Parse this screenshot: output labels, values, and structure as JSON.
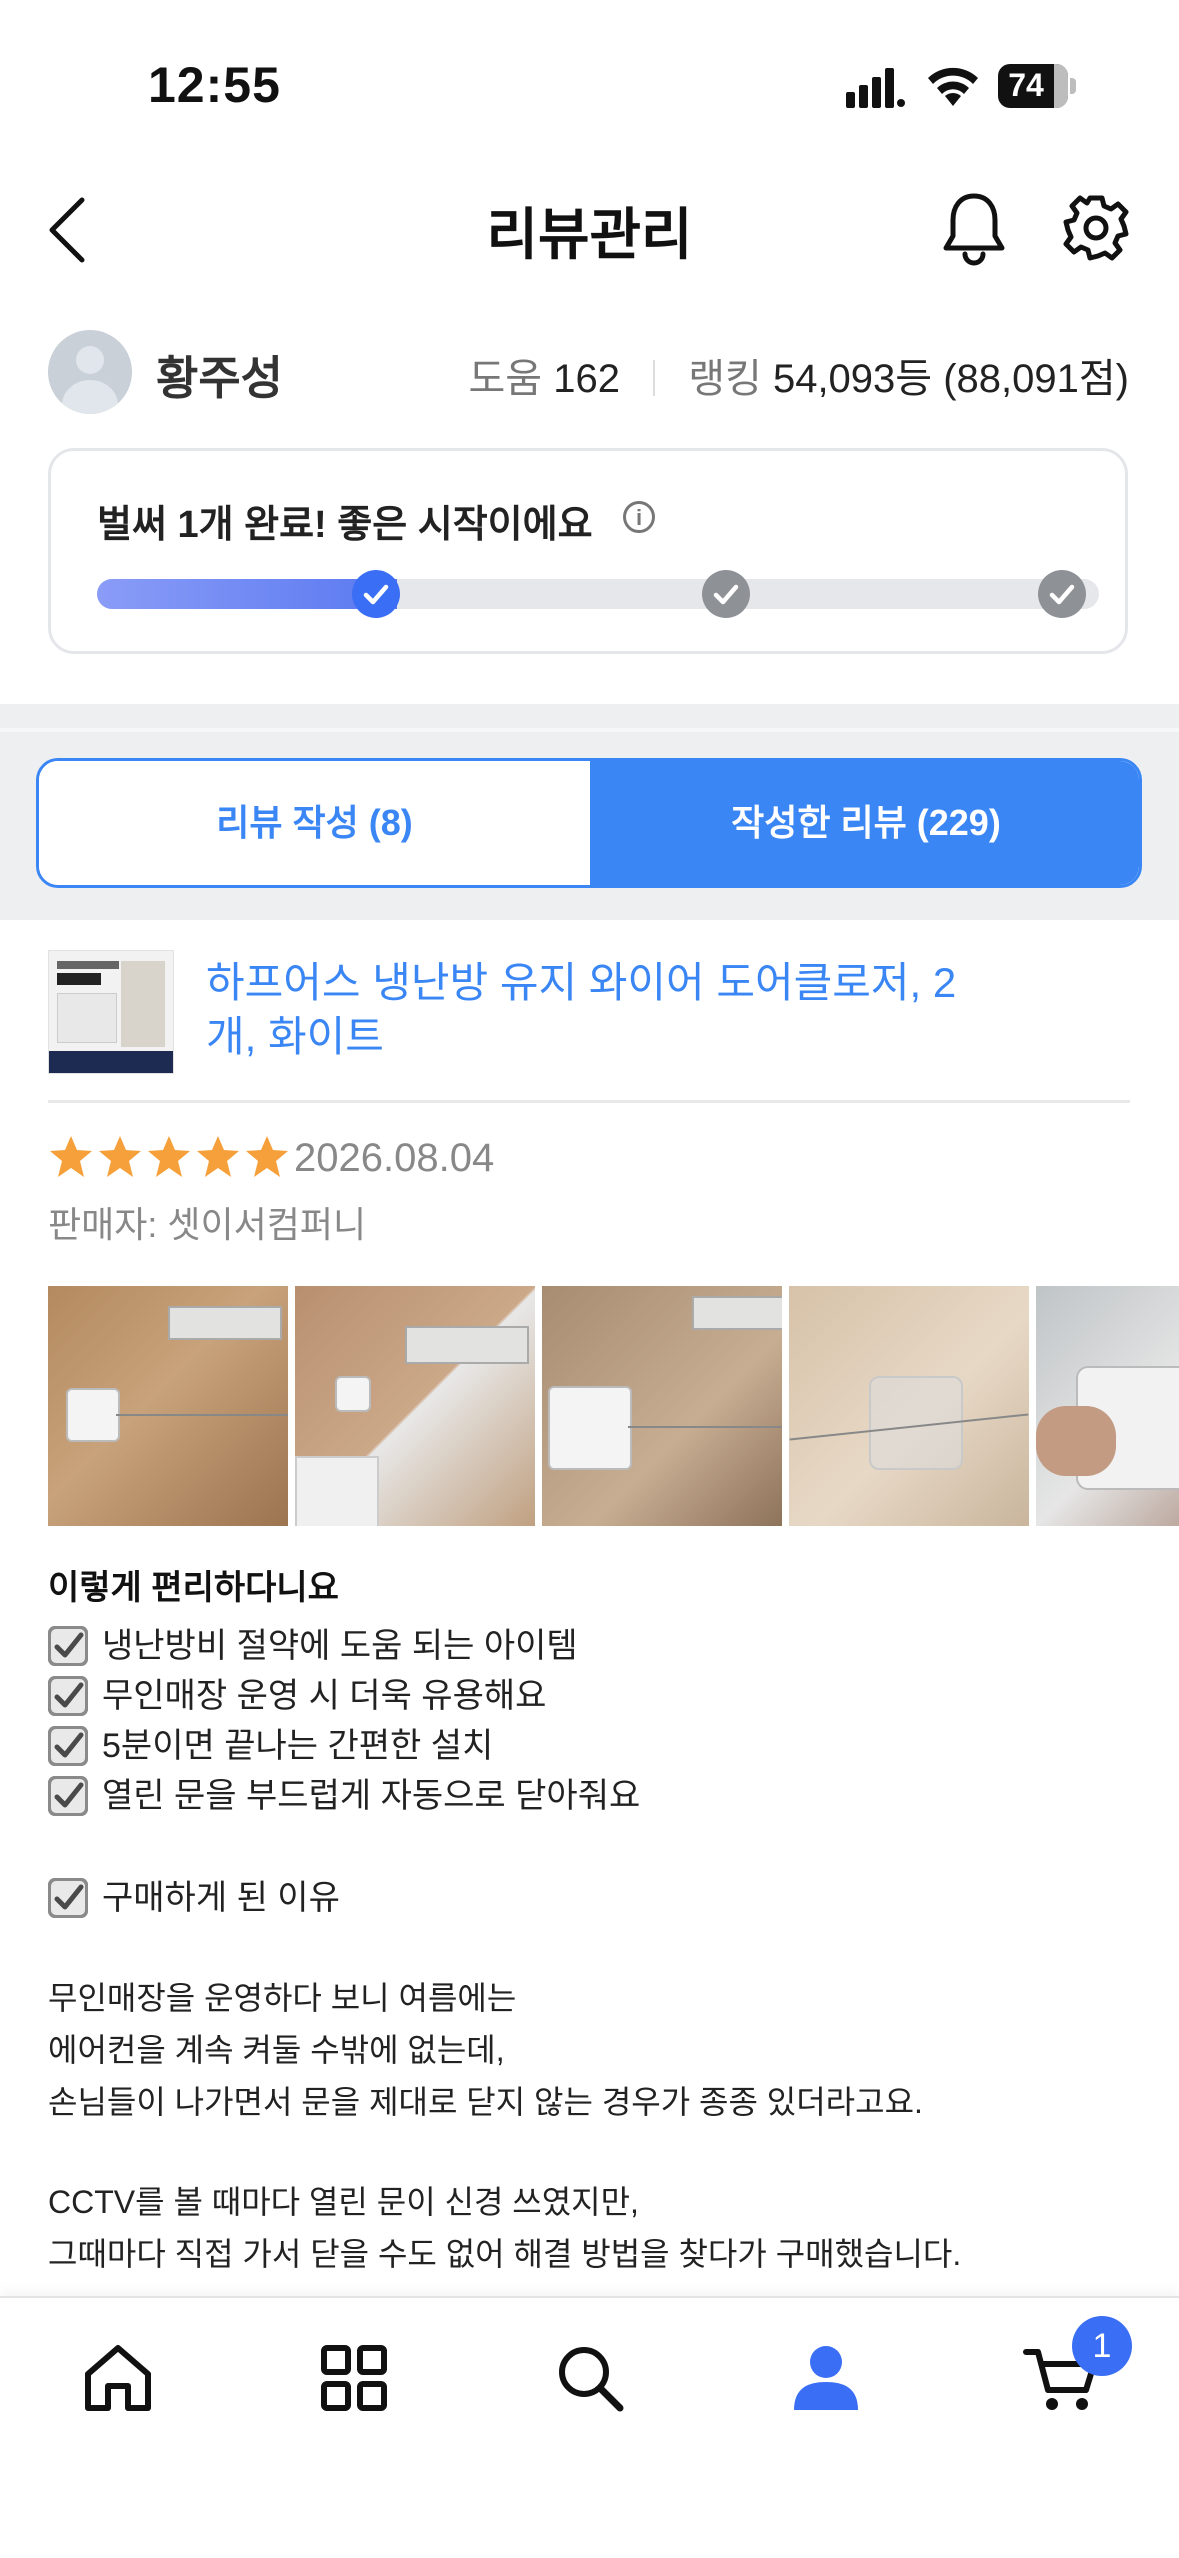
{
  "status_bar": {
    "time": "12:55",
    "battery": "74"
  },
  "header": {
    "title": "리뷰관리"
  },
  "profile": {
    "name": "황주성",
    "help_label": "도움",
    "help_value": "162",
    "ranking_label": "랭킹",
    "ranking_value": "54,093등 (88,091점)"
  },
  "progress": {
    "title": "벌써 1개 완료! 좋은 시작이에요",
    "info_glyph": "i",
    "completed": 1,
    "total": 3
  },
  "tabs": {
    "write": "리뷰 작성 (8)",
    "written": "작성한 리뷰 (229)",
    "active": "written"
  },
  "review": {
    "product_title": "하프어스 냉난방 유지 와이어 도어클로저, 2 개, 화이트",
    "rating": 5,
    "date": "2026.08.04",
    "seller": "판매자: 셋이서컴퍼니",
    "photo_count": 5,
    "headline": "이렇게 편리하다니요",
    "checklist": [
      "냉난방비 절약에 도움 되는 아이템",
      "무인매장 운영 시 더욱 유용해요",
      "5분이면 끝나는 간편한 설치",
      "열린 문을 부드럽게 자동으로 닫아줘요"
    ],
    "reason_label": "구매하게 된 이유",
    "paragraph1": [
      "무인매장을 운영하다 보니 여름에는",
      "에어컨을 계속 켜둘 수밖에 없는데,",
      "손님들이 나가면서 문을 제대로 닫지 않는 경우가 종종 있더라고요."
    ],
    "paragraph2": [
      "CCTV를 볼 때마다 열린 문이 신경 쓰였지만,",
      "그때마다 직접 가서 닫을 수도 없어 해결 방법을 찾다가 구매했습니다."
    ]
  },
  "bottom_nav": {
    "items": [
      "home-icon",
      "category-grid-icon",
      "search-icon",
      "my-profile-icon",
      "cart-icon"
    ],
    "active": "my-profile-icon",
    "cart_badge": "1"
  },
  "colors": {
    "accent": "#3a86f5",
    "star": "#f5a03a",
    "nav_active": "#3a6ef5"
  }
}
